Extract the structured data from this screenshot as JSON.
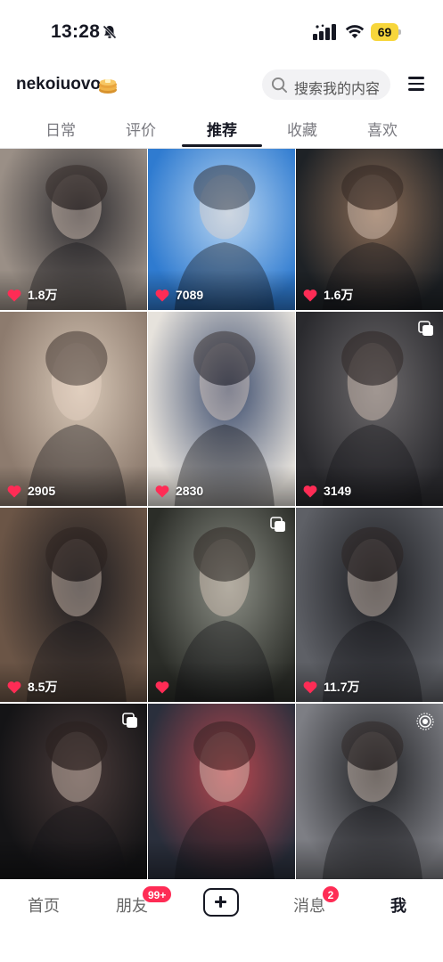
{
  "status_bar": {
    "time": "13:28",
    "battery": "69",
    "icons": [
      "bell-muted-icon",
      "cellular-signal-icon",
      "wifi-icon",
      "battery-icon"
    ]
  },
  "header": {
    "username": "nekoiuovo",
    "username_emoji_icon": "pancake-icon",
    "search_placeholder": "搜索我的内容",
    "menu_icon": "hamburger-menu-icon"
  },
  "tabs": [
    {
      "label": "日常"
    },
    {
      "label": "评价"
    },
    {
      "label": "推荐",
      "active": true
    },
    {
      "label": "收藏"
    },
    {
      "label": "喜欢"
    }
  ],
  "grid": {
    "accent_heart": "#fe2c55",
    "tiles": [
      {
        "likes": "1.8万",
        "overlay": "",
        "tone": [
          "#9a8f86",
          "#2b2a2e"
        ]
      },
      {
        "likes": "7089",
        "overlay": "",
        "tone": [
          "#2f7bd0",
          "#b9d6f2"
        ]
      },
      {
        "likes": "1.6万",
        "overlay": "",
        "tone": [
          "#1e2226",
          "#8a6b55"
        ]
      },
      {
        "likes": "2905",
        "overlay": "",
        "tone": [
          "#8d7b6e",
          "#d9c9b8"
        ]
      },
      {
        "likes": "2830",
        "overlay": "",
        "tone": [
          "#e6e2dc",
          "#3a4a6b"
        ]
      },
      {
        "likes": "3149",
        "overlay": "multi-image-icon",
        "tone": [
          "#2a2a2e",
          "#6d6a6c"
        ]
      },
      {
        "likes": "8.5万",
        "overlay": "",
        "tone": [
          "#6b5546",
          "#1a1a1e"
        ]
      },
      {
        "likes": "",
        "overlay": "multi-image-icon",
        "tone": [
          "#2b2d28",
          "#8c8f86"
        ]
      },
      {
        "likes": "11.7万",
        "overlay": "",
        "tone": [
          "#5e6066",
          "#1b1c20"
        ]
      },
      {
        "likes": "",
        "overlay": "multi-image-icon",
        "tone": [
          "#141416",
          "#4a3b3a"
        ]
      },
      {
        "likes": "",
        "overlay": "",
        "tone": [
          "#2a2f3c",
          "#b7474f"
        ]
      },
      {
        "likes": "",
        "overlay": "live-photo-icon",
        "tone": [
          "#7d7e84",
          "#202124"
        ]
      }
    ]
  },
  "bottom_nav": {
    "home": "首页",
    "friends": "朋友",
    "friends_badge": "99+",
    "create_icon": "plus-icon",
    "messages": "消息",
    "messages_badge": "2",
    "me": "我"
  }
}
